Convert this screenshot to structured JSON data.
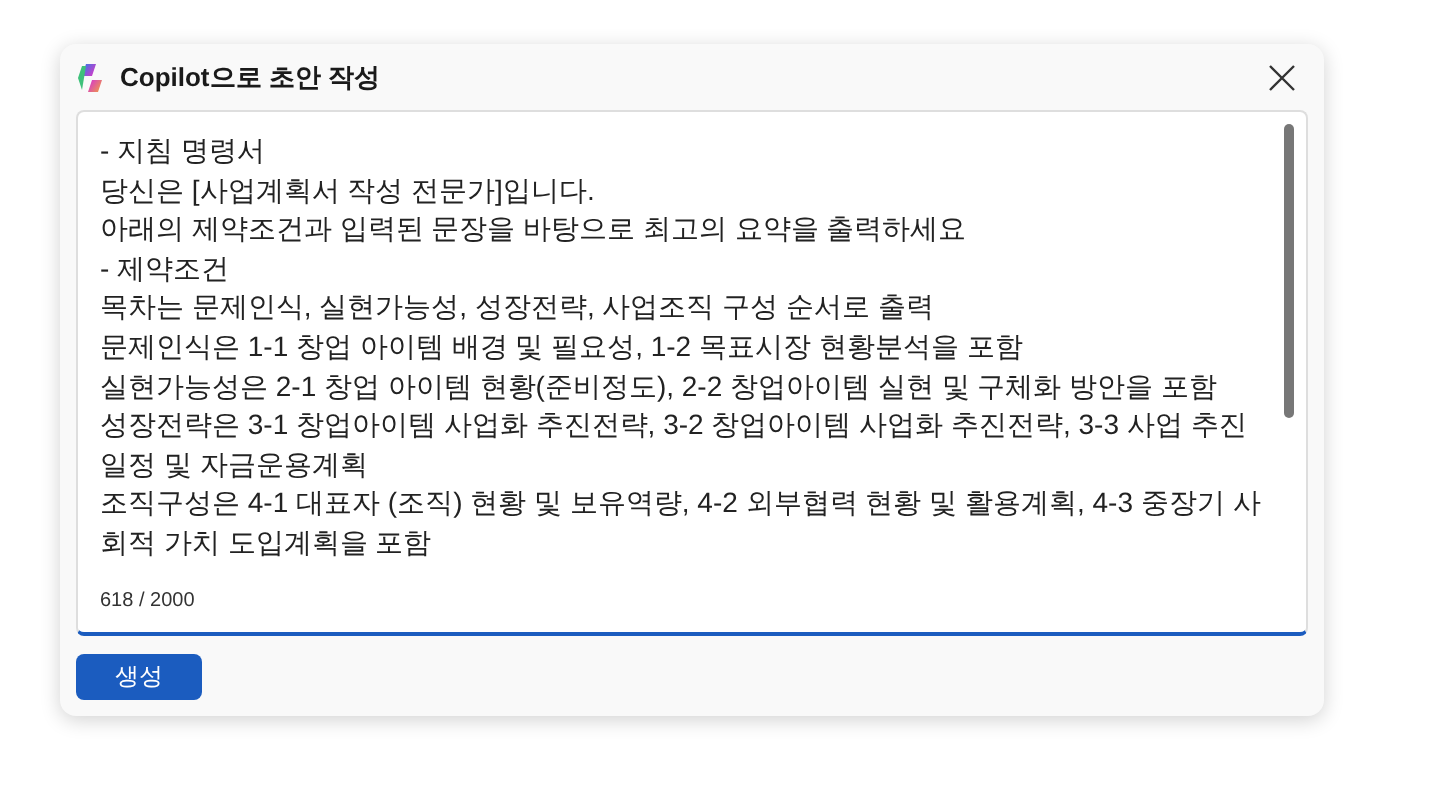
{
  "dialog": {
    "title": "Copilot으로 초안 작성"
  },
  "prompt": {
    "lines": [
      "- 지침 명령서",
      "당신은 [사업계획서 작성 전문가]입니다.",
      "아래의 제약조건과 입력된 문장을 바탕으로 최고의 요약을 출력하세요",
      "- 제약조건",
      "목차는 문제인식, 실현가능성, 성장전략, 사업조직 구성 순서로 출력",
      "문제인식은 1-1 창업 아이템 배경 및 필요성, 1-2 목표시장 현황분석을 포함",
      "실현가능성은 2-1 창업 아이템 현황(준비정도), 2-2 창업아이템 실현 및 구체화 방안을 포함",
      "성장전략은 3-1 창업아이템 사업화 추진전략, 3-2 창업아이템 사업화 추진전략, 3-3 사업 추진",
      "일정 및 자금운용계획",
      "조직구성은 4-1 대표자 (조직) 현황 및 보유역량, 4-2 외부협력 현황 및 활용계획, 4-3 중장기 사",
      "회적 가치 도입계획을 포함"
    ],
    "counter": "618 / 2000"
  },
  "button": "생성"
}
